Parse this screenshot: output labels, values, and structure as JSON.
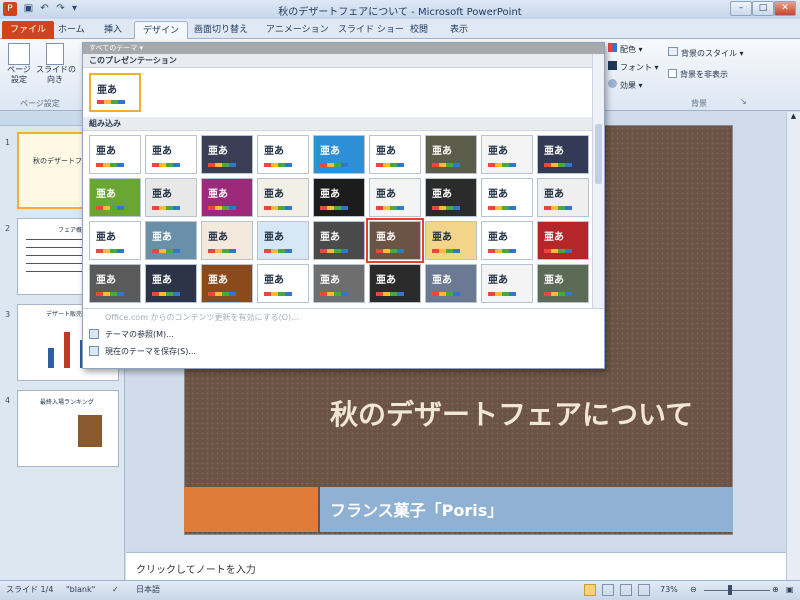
{
  "window": {
    "title": "秋のデザートフェアについて - Microsoft PowerPoint",
    "controls": [
      "–",
      "□",
      "✕"
    ]
  },
  "tabs": [
    {
      "label": "ファイル"
    },
    {
      "label": "ホーム"
    },
    {
      "label": "挿入"
    },
    {
      "label": "デザイン"
    },
    {
      "label": "画面切り替え"
    },
    {
      "label": "アニメーション"
    },
    {
      "label": "スライド ショー"
    },
    {
      "label": "校閲"
    },
    {
      "label": "表示"
    }
  ],
  "ribbon": {
    "page_setup_label": "ページ\n設定",
    "orientation_label": "スライドの\n向き",
    "group_page_setup": "ページ設定",
    "colors_label": "配色",
    "fonts_label": "フォント",
    "effects_label": "効果",
    "bg_styles_label": "背景のスタイル",
    "hide_bg_label": "背景を非表示",
    "group_background": "背景"
  },
  "gallery": {
    "header": "すべてのテーマ ▾",
    "section_current": "このプレゼンテーション",
    "section_builtin": "組み込み",
    "sample_text": "亜あ",
    "menu": {
      "enable_updates": "Office.com からのコンテンツ更新を有効にする(O)...",
      "browse": "テーマの参照(M)...",
      "save_current": "現在のテーマを保存(S)..."
    },
    "themes": [
      [
        "#ffffff",
        "#ffffff",
        "#3a3f55",
        "#ffffff",
        "#2d8fd5",
        "#ffffff",
        "#5c5c4a",
        "#f4f4f4",
        "#333a55"
      ],
      [
        "#6aa632",
        "#e8e8e8",
        "#9b2b7a",
        "#f2efe7",
        "#1c1c1c",
        "#f4f4f4",
        "#2b2b2b",
        "#ffffff",
        "#efefef"
      ],
      [
        "#ffffff",
        "#6a8fa8",
        "#f3e9dd",
        "#d8e7f5",
        "#4a4a4a",
        "#6b5445",
        "#f2d48a",
        "#ffffff",
        "#b5262a"
      ],
      [
        "#5a5a5a",
        "#2e3448",
        "#8a4a1c",
        "#ffffff",
        "#6e6e6e",
        "#2a2a2a",
        "#6b7a92",
        "#f4f4f4",
        "#5c6b55"
      ]
    ],
    "text_colors": [
      [
        "#1e2d44",
        "#1e2d44",
        "#ffffff",
        "#1e2d44",
        "#ffffff",
        "#1e2d44",
        "#ffffff",
        "#1e2d44",
        "#ffffff"
      ],
      [
        "#ffffff",
        "#1e2d44",
        "#ffffff",
        "#1e2d44",
        "#ffffff",
        "#1e2d44",
        "#ffffff",
        "#1e2d44",
        "#1e2d44"
      ],
      [
        "#1e2d44",
        "#ffffff",
        "#1e2d44",
        "#1e2d44",
        "#ffffff",
        "#ffffff",
        "#1e2d44",
        "#1e2d44",
        "#ffffff"
      ],
      [
        "#ffffff",
        "#ffffff",
        "#ffffff",
        "#1e2d44",
        "#ffffff",
        "#ffffff",
        "#ffffff",
        "#1e2d44",
        "#ffffff"
      ]
    ]
  },
  "slides": [
    {
      "num": "1",
      "text": "秋のデザートフェア"
    },
    {
      "num": "2",
      "text": "フェア概要"
    },
    {
      "num": "3",
      "text": "デザート販売数"
    },
    {
      "num": "4",
      "text": "最終入場ランキング"
    }
  ],
  "slide": {
    "title": "秋のデザートフェアについて",
    "subtitle": "フランス菓子「Poris」"
  },
  "notes": {
    "placeholder": "クリックしてノートを入力"
  },
  "status": {
    "slide": "スライド 1/4",
    "theme": "\"blank\"",
    "language": "日本語",
    "zoom": "73%"
  }
}
